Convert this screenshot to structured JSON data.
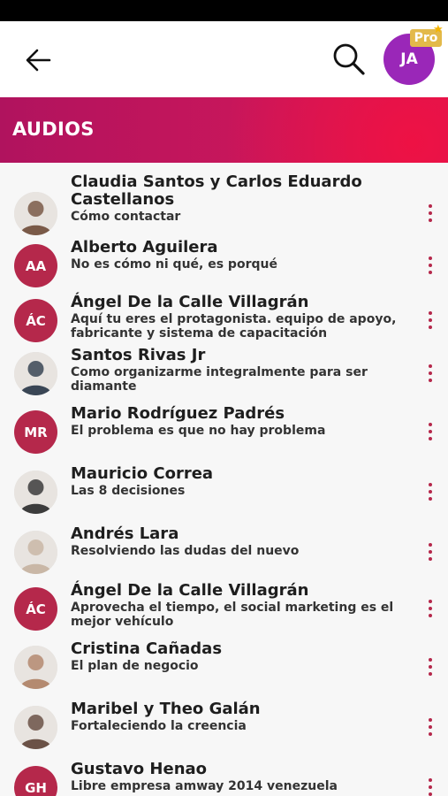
{
  "appbar": {
    "user_initials": "JA",
    "pro_label": "Pro"
  },
  "section": {
    "title": "AUDIOS"
  },
  "audios": [
    {
      "title": "Claudia Santos y Carlos Eduardo Castellanos",
      "subtitle": "Cómo contactar",
      "avatar": "photo"
    },
    {
      "title": "Alberto Aguilera",
      "subtitle": "No es cómo ni qué, es porqué",
      "avatar": "initials",
      "initials": "AA"
    },
    {
      "title": "Ángel De la Calle Villagrán",
      "subtitle": "Aquí tu eres el protagonista. equipo de apoyo, fabricante y sistema de capacitación",
      "avatar": "initials",
      "initials": "ÁC"
    },
    {
      "title": "Santos Rivas Jr",
      "subtitle": "Como organizarme integralmente para ser diamante",
      "avatar": "photo"
    },
    {
      "title": "Mario Rodríguez Padrés",
      "subtitle": "El problema es que no hay problema",
      "avatar": "initials",
      "initials": "MR"
    },
    {
      "title": "Mauricio Correa",
      "subtitle": "Las 8 decisiones",
      "avatar": "photo"
    },
    {
      "title": "Andrés Lara",
      "subtitle": "Resolviendo las dudas del nuevo",
      "avatar": "photo"
    },
    {
      "title": "Ángel De la Calle Villagrán",
      "subtitle": "Aprovecha el tiempo, el social marketing es el mejor vehículo",
      "avatar": "initials",
      "initials": "ÁC"
    },
    {
      "title": "Cristina Cañadas",
      "subtitle": "El plan de negocio",
      "avatar": "photo"
    },
    {
      "title": "Maribel y Theo Galán",
      "subtitle": "Fortaleciendo la creencia",
      "avatar": "photo"
    },
    {
      "title": "Gustavo Henao",
      "subtitle": "Libre empresa amway 2014 venezuela",
      "avatar": "initials",
      "initials": "GH"
    }
  ],
  "colors": {
    "accent": "#b5284b",
    "header_start": "#b0135e",
    "header_end": "#ee1144",
    "user_avatar": "#9a27b8",
    "pro_badge": "#e3b94a"
  }
}
